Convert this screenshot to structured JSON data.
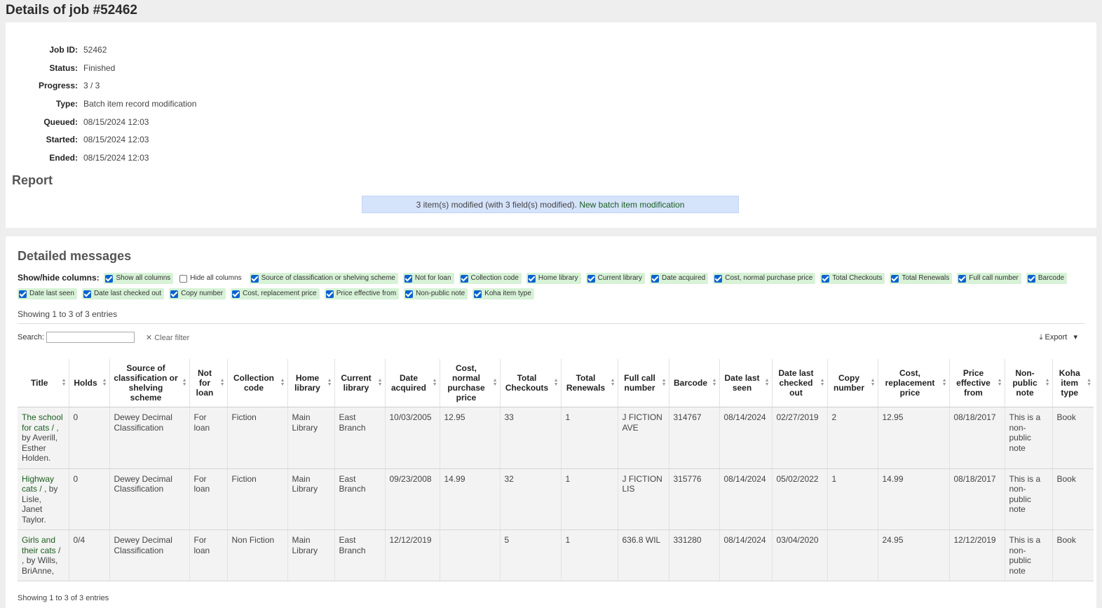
{
  "page": {
    "title": "Details of job #52462"
  },
  "job": {
    "rows": [
      {
        "label": "Job ID:",
        "value": "52462"
      },
      {
        "label": "Status:",
        "value": "Finished"
      },
      {
        "label": "Progress:",
        "value": "3 / 3"
      },
      {
        "label": "Type:",
        "value": "Batch item record modification"
      },
      {
        "label": "Queued:",
        "value": "08/15/2024 12:03"
      },
      {
        "label": "Started:",
        "value": "08/15/2024 12:03"
      },
      {
        "label": "Ended:",
        "value": "08/15/2024 12:03"
      }
    ]
  },
  "report": {
    "heading": "Report",
    "message": "3 item(s) modified (with 3 field(s) modified).",
    "link": "New batch item modification"
  },
  "detailed": {
    "heading": "Detailed messages",
    "colvis_label": "Show/hide columns:",
    "chips": [
      {
        "label": "Show all columns",
        "checked": true
      },
      {
        "label": "Hide all columns",
        "checked": false
      },
      {
        "label": "Source of classification or shelving scheme",
        "checked": true
      },
      {
        "label": "Not for loan",
        "checked": true
      },
      {
        "label": "Collection code",
        "checked": true
      },
      {
        "label": "Home library",
        "checked": true
      },
      {
        "label": "Current library",
        "checked": true
      },
      {
        "label": "Date acquired",
        "checked": true
      },
      {
        "label": "Cost, normal purchase price",
        "checked": true
      },
      {
        "label": "Total Checkouts",
        "checked": true
      },
      {
        "label": "Total Renewals",
        "checked": true
      },
      {
        "label": "Full call number",
        "checked": true
      },
      {
        "label": "Barcode",
        "checked": true
      },
      {
        "label": "Date last seen",
        "checked": true
      },
      {
        "label": "Date last checked out",
        "checked": true
      },
      {
        "label": "Copy number",
        "checked": true
      },
      {
        "label": "Cost, replacement price",
        "checked": true
      },
      {
        "label": "Price effective from",
        "checked": true
      },
      {
        "label": "Non-public note",
        "checked": true
      },
      {
        "label": "Koha item type",
        "checked": true
      }
    ],
    "info_top": "Showing 1 to 3 of 3 entries",
    "search_label": "Search:",
    "search_placeholder": "",
    "clear_filter": "Clear filter",
    "export": "Export",
    "info_bottom": "Showing 1 to 3 of 3 entries",
    "headers": [
      "Title",
      "Holds",
      "Source of classification or shelving scheme",
      "Not for loan",
      "Collection code",
      "Home library",
      "Current library",
      "Date acquired",
      "Cost, normal purchase price",
      "Total Checkouts",
      "Total Renewals",
      "Full call number",
      "Barcode",
      "Date last seen",
      "Date last checked out",
      "Copy number",
      "Cost, replacement price",
      "Price effective from",
      "Non-public note",
      "Koha item type"
    ],
    "rows": [
      [
        "The school for cats / , by Averill, Esther Holden.",
        "0",
        "Dewey Decimal Classification",
        "For loan",
        "Fiction",
        "Main Library",
        "East Branch",
        "10/03/2005",
        "12.95",
        "33",
        "1",
        "J FICTION AVE",
        "314767",
        "08/14/2024",
        "02/27/2019",
        "2",
        "12.95",
        "08/18/2017",
        "This is a non-public note",
        "Book"
      ],
      [
        "Highway cats / , by Lisle, Janet Taylor.",
        "0",
        "Dewey Decimal Classification",
        "For loan",
        "Fiction",
        "Main Library",
        "East Branch",
        "09/23/2008",
        "14.99",
        "32",
        "1",
        "J FICTION LIS",
        "315776",
        "08/14/2024",
        "05/02/2022",
        "1",
        "14.99",
        "08/18/2017",
        "This is a non-public note",
        "Book"
      ],
      [
        "Girls and their cats / , by Wills, BriAnne,",
        "0/4",
        "Dewey Decimal Classification",
        "For loan",
        "Non Fiction",
        "Main Library",
        "East Branch",
        "12/12/2019",
        "",
        "5",
        "1",
        "636.8 WIL",
        "331280",
        "08/14/2024",
        "03/04/2020",
        "",
        "24.95",
        "12/12/2019",
        "This is a non-public note",
        "Book"
      ]
    ],
    "title_links": [
      "The school for cats / ,",
      "Highway cats / ,",
      "Girls and their cats / ,"
    ],
    "title_authors": [
      "by Averill, Esther Holden.",
      "by Lisle, Janet Taylor.",
      "by Wills, BriAnne,"
    ]
  },
  "icons": {
    "clear": "x-icon",
    "export": "download-icon",
    "sort": "sort-icon"
  }
}
